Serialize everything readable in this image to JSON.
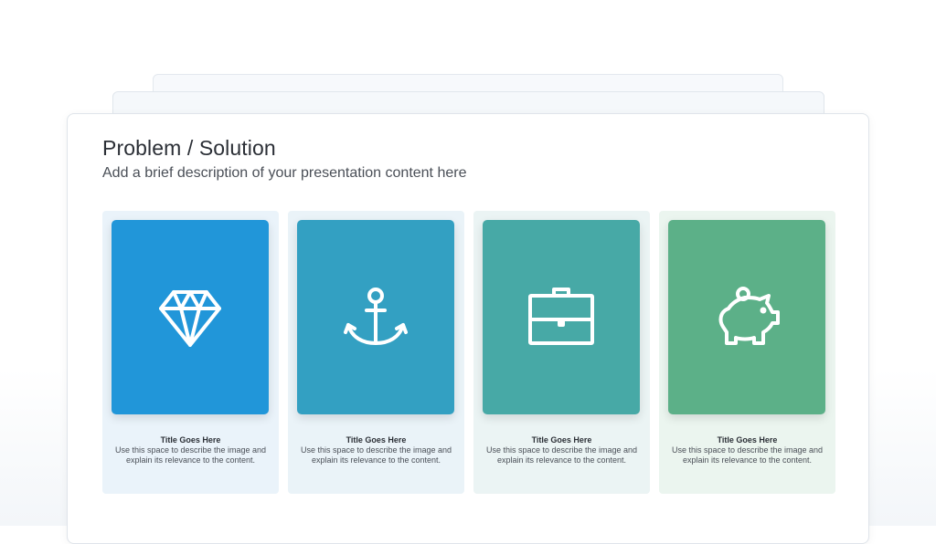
{
  "slide": {
    "title": "Problem / Solution",
    "subtitle": "Add a brief description of your presentation content here"
  },
  "cards": [
    {
      "icon": "diamond-icon",
      "color": "#2196d9",
      "bg": "#eaf3fa",
      "title": "Title Goes Here",
      "description": "Use this space to describe the image and explain its relevance to the content."
    },
    {
      "icon": "anchor-icon",
      "color": "#33a0c2",
      "bg": "#eaf3f8",
      "title": "Title Goes Here",
      "description": "Use this space to describe the image and explain its relevance to the content."
    },
    {
      "icon": "briefcase-icon",
      "color": "#47a9a6",
      "bg": "#ebf4f4",
      "title": "Title Goes Here",
      "description": "Use this space to describe the image and explain its relevance to the content."
    },
    {
      "icon": "piggy-bank-icon",
      "color": "#5cb088",
      "bg": "#ebf5ef",
      "title": "Title Goes Here",
      "description": "Use this space to describe the image and explain its relevance to the content."
    }
  ]
}
